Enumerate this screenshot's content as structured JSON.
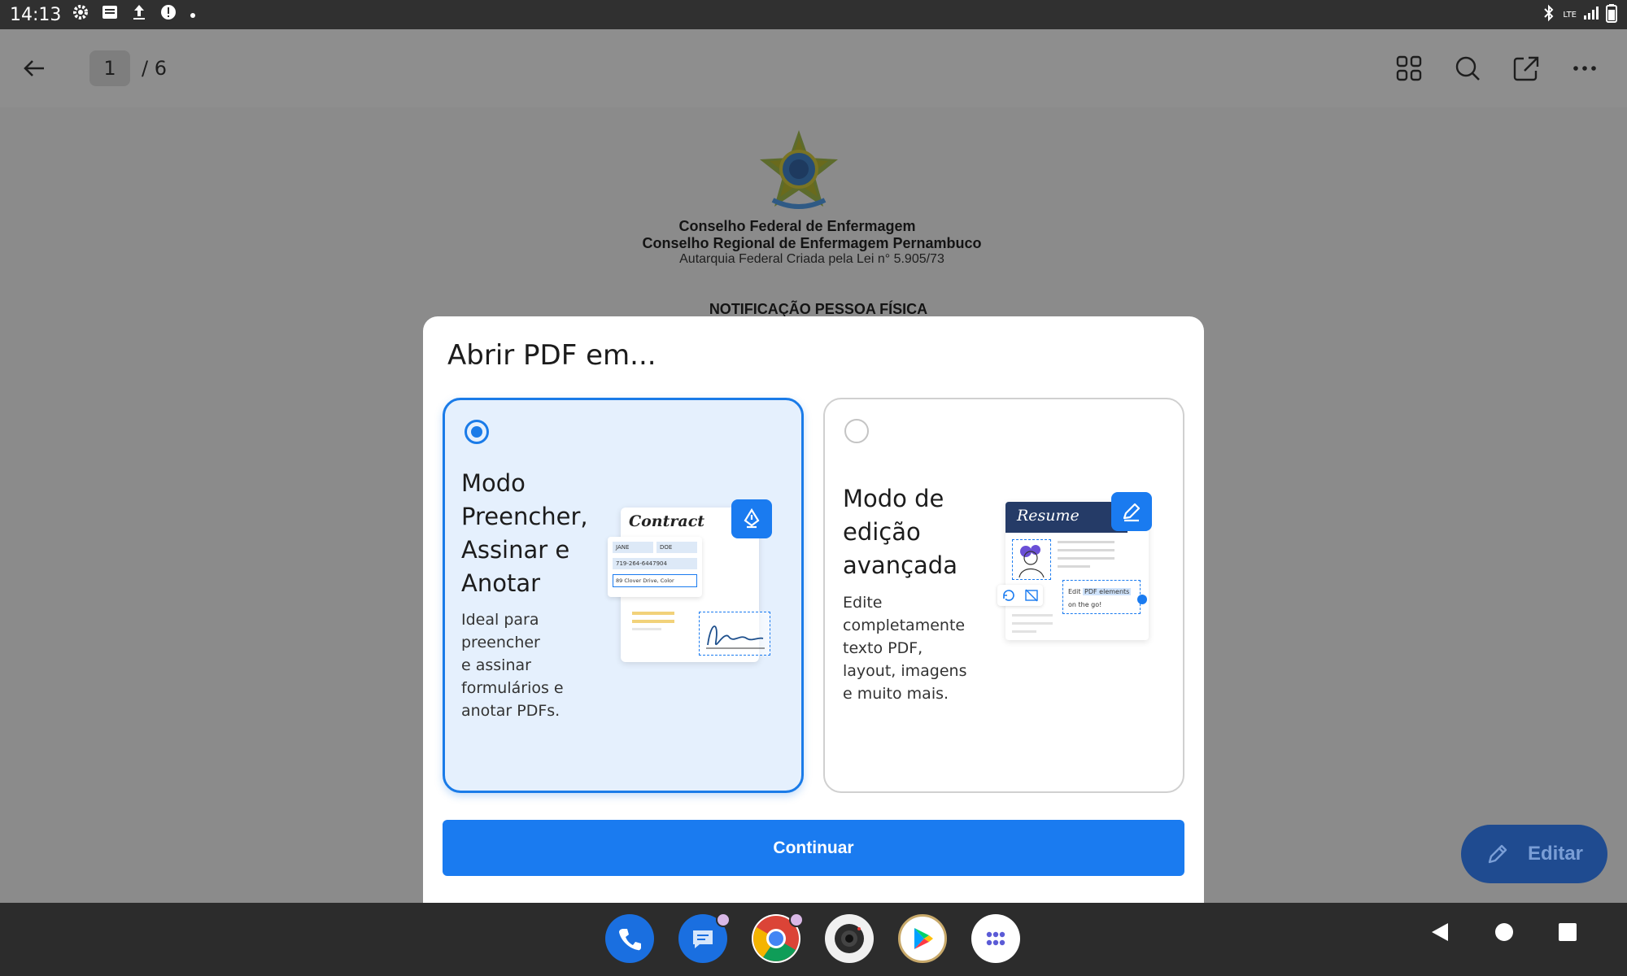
{
  "status_bar": {
    "time": "14:13",
    "network": "LTE"
  },
  "toolbar": {
    "current_page": "1",
    "total_pages": "/ 6"
  },
  "document": {
    "line1": "Conselho Federal de Enfermagem",
    "line2": "Conselho Regional de Enfermagem Pernambuco",
    "line3": "Autarquia Federal Criada pela Lei n° 5.905/73",
    "line4": "NOTIFICAÇÃO PESSOA FÍSICA"
  },
  "fab": {
    "label": "Editar"
  },
  "dialog": {
    "title": "Abrir PDF em...",
    "options": [
      {
        "title_lines": [
          "Modo",
          "Preencher,",
          "Assinar e",
          "Anotar"
        ],
        "desc_lines": [
          "Ideal para",
          "preencher",
          "e assinar",
          "formulários e",
          "anotar PDFs."
        ],
        "selected": true,
        "illustration": {
          "heading": "Contract",
          "field1": "JANE",
          "field2": "DOE",
          "field3": "719-264-6447904",
          "field4": "89 Clover Drive, Color"
        }
      },
      {
        "title_lines": [
          "Modo de",
          "edição",
          "avançada"
        ],
        "desc_lines": [
          "Edite",
          "completamente",
          "texto PDF,",
          "layout, imagens",
          "e muito mais."
        ],
        "selected": false,
        "illustration": {
          "heading": "Resume",
          "edit_word": "Edit",
          "highlight": "PDF elements",
          "tail": "on the go!"
        }
      }
    ],
    "continue_label": "Continuar"
  },
  "colors": {
    "accent": "#1a7bf0",
    "selected_bg": "#e5f0fd",
    "fab_bg": "#1f4b90"
  }
}
